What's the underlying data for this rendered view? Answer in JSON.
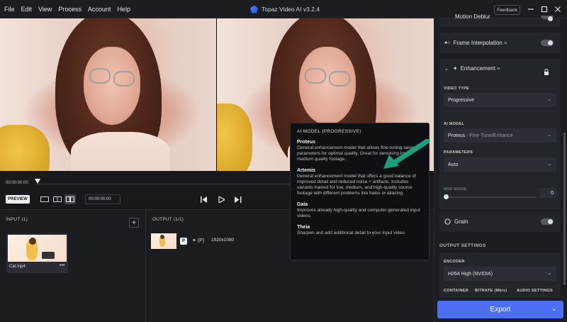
{
  "app": {
    "title": "Topaz Video AI  v3.2.4",
    "feedback": "Feedback"
  },
  "menu": {
    "items": [
      "File",
      "Edit",
      "View",
      "Process",
      "Account",
      "Help"
    ]
  },
  "timeline": {
    "start_time": "00:00:00:00",
    "end_time": ""
  },
  "controls": {
    "preview_label": "PREVIEW",
    "time_value": "00:00:00:00"
  },
  "input": {
    "header": "INPUT (1)",
    "clip_name": "Cat.mp4"
  },
  "output": {
    "header": "OUTPUT (1/1)",
    "badge": "P",
    "model_tag": "(P)",
    "resolution": "1920x1080"
  },
  "tooltip": {
    "title": "AI MODEL (PROGRESSIVE)",
    "models": [
      {
        "name": "Proteus",
        "desc": "General enhancement model that allows fine-tuning several parameters for optimal quality. Great for denoising low to medium quality footage."
      },
      {
        "name": "Artemis",
        "desc": "General enhancement model that offers a good balance of improved detail and reduced noise + artifacts. Includes variants trained for low, medium, and high-quality source footage with different problems like halos or aliasing."
      },
      {
        "name": "Gaia",
        "desc": "Improves already high-quality and computer-generated input videos."
      },
      {
        "name": "Theia",
        "desc": "Sharpen and add additional detail to your input video."
      }
    ]
  },
  "sidebar": {
    "motion_deblur": "Motion Deblur",
    "frame_interpolation": "Frame Interpolation",
    "ai_superscript": "AI",
    "enhancement": "Enhancement",
    "video_type_label": "VIDEO TYPE",
    "video_type_value": "Progressive",
    "ai_model_label": "AI MODEL",
    "ai_model_value": "Proteus",
    "ai_model_variant": " - Fine-Tune/Enhance",
    "parameters_label": "PARAMETERS",
    "parameters_value": "Auto",
    "add_noise_label": "ADD NOISE",
    "add_noise_value": "0",
    "grain": "Grain",
    "output_settings": "OUTPUT SETTINGS",
    "encoder_label": "ENCODER",
    "encoder_value": "H264 High (NVIDIA)",
    "container_label": "CONTAINER",
    "bitrate_label": "BITRATE (Mb/s)",
    "audio_label": "AUDIO SETTINGS",
    "export": "Export"
  },
  "colors": {
    "accent": "#4d6ef0",
    "arrow": "#1e9e7c",
    "background": "#15171b"
  }
}
